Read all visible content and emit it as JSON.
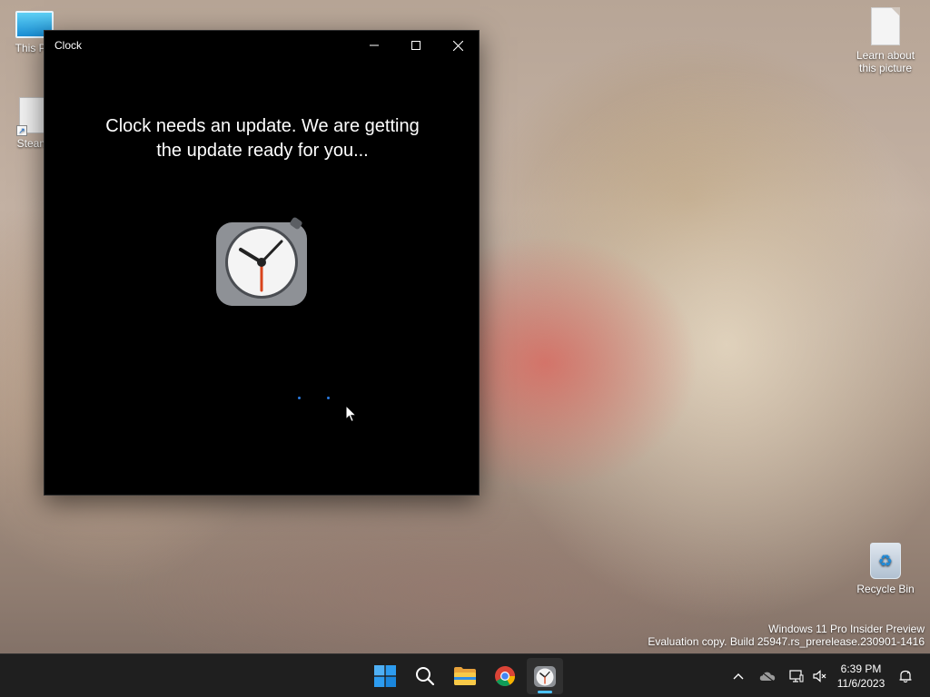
{
  "desktop": {
    "icons": [
      {
        "label": "This PC"
      },
      {
        "label": "Steam"
      },
      {
        "label": "Learn about this picture"
      },
      {
        "label": "Recycle Bin"
      }
    ],
    "watermark": {
      "line1": "Windows 11 Pro Insider Preview",
      "line2": "Evaluation copy. Build 25947.rs_prerelease.230901-1416"
    }
  },
  "window": {
    "title": "Clock",
    "message": "Clock needs an update. We are getting the update ready for you...",
    "controls": [
      "minimize-icon",
      "maximize-icon",
      "close-icon"
    ],
    "accent": "#2a7be0"
  },
  "taskbar": {
    "apps": [
      "start-icon",
      "search-icon",
      "file-explorer-icon",
      "chrome-icon",
      "clock-app-icon"
    ],
    "active_app": "clock-app-icon",
    "tray_icons": [
      "chevron-up-icon",
      "onedrive-icon",
      "network-icon",
      "volume-muted-icon",
      "notification-icon"
    ],
    "time": "6:39 PM",
    "date": "11/6/2023",
    "active_color": "#4cc2ff"
  }
}
